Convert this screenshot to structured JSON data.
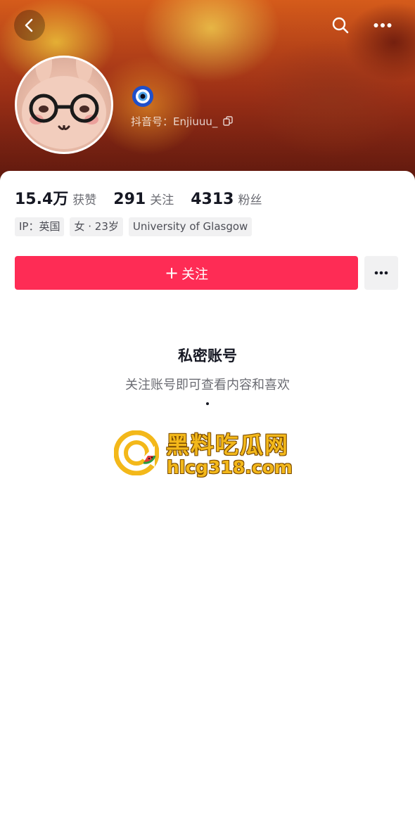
{
  "header": {
    "back_icon": "chevron-left-icon",
    "search_icon": "search-icon",
    "more_icon": "ellipsis-icon",
    "badge_icon": "evil-eye-emoji-icon",
    "handle_label": "抖音号：Enjiuuu_",
    "copy_icon": "copy-icon"
  },
  "stats": [
    {
      "value": "15.4万",
      "label": "获赞"
    },
    {
      "value": "291",
      "label": "关注"
    },
    {
      "value": "4313",
      "label": "粉丝"
    }
  ],
  "tags": [
    "IP：英国",
    "女 · 23岁",
    "University of Glasgow"
  ],
  "actions": {
    "follow_plus": "+",
    "follow_label": "关注",
    "more_icon": "ellipsis-icon"
  },
  "private": {
    "title": "私密账号",
    "subtitle": "关注账号即可查看内容和喜欢"
  },
  "watermark": {
    "name": "黑料吃瓜网",
    "url": "hlcg318.com"
  },
  "colors": {
    "accent": "#fe2c55",
    "text_primary": "#161823",
    "text_secondary": "#6b6c73",
    "tag_bg": "#f1f1f2",
    "watermark_yellow": "#f3b81a"
  }
}
